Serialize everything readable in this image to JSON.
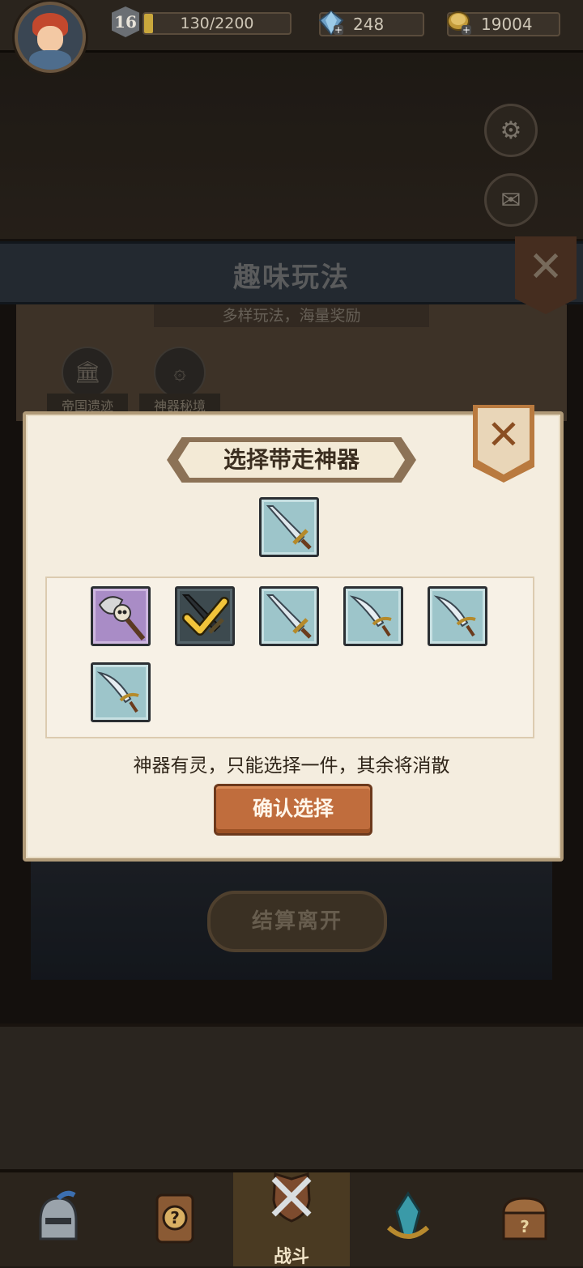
{
  "header": {
    "level": "16",
    "xp_text": "130/2200",
    "xp_progress": 0.059,
    "gems": "248",
    "gold": "19004"
  },
  "side_buttons": {
    "settings_icon": "gear-icon",
    "mail_icon": "envelope-icon"
  },
  "fun_panel": {
    "title": "趣味玩法",
    "subtitle": "多样玩法，海量奖励",
    "modes": [
      {
        "label": "帝国遗迹"
      },
      {
        "label": "神器秘境"
      }
    ],
    "settle_label": "结算离开"
  },
  "modal": {
    "title": "选择带走神器",
    "hint": "神器有灵，只能选择一件，其余将消散",
    "confirm_label": "确认选择",
    "selected_item": "silver-sword",
    "items": [
      {
        "icon": "skull-axe",
        "rarity": "purple",
        "checked": false
      },
      {
        "icon": "dark-sword",
        "rarity": "dark",
        "checked": true
      },
      {
        "icon": "silver-sword",
        "rarity": "blue",
        "checked": false
      },
      {
        "icon": "curved-blade",
        "rarity": "blue",
        "checked": false
      },
      {
        "icon": "curved-blade",
        "rarity": "blue",
        "checked": false
      },
      {
        "icon": "curved-blade",
        "rarity": "blue",
        "checked": false
      }
    ]
  },
  "nav": {
    "items": [
      {
        "icon": "knight-helmet-icon"
      },
      {
        "icon": "mystery-card-icon"
      },
      {
        "icon": "crossed-swords-icon",
        "label": "战斗"
      },
      {
        "icon": "crystal-icon"
      },
      {
        "icon": "treasure-chest-icon"
      }
    ],
    "active_label": "战斗"
  },
  "colors": {
    "accent_orange": "#c06d3d",
    "panel_bg": "#f4eddf",
    "nav_bg": "#2b241c"
  }
}
